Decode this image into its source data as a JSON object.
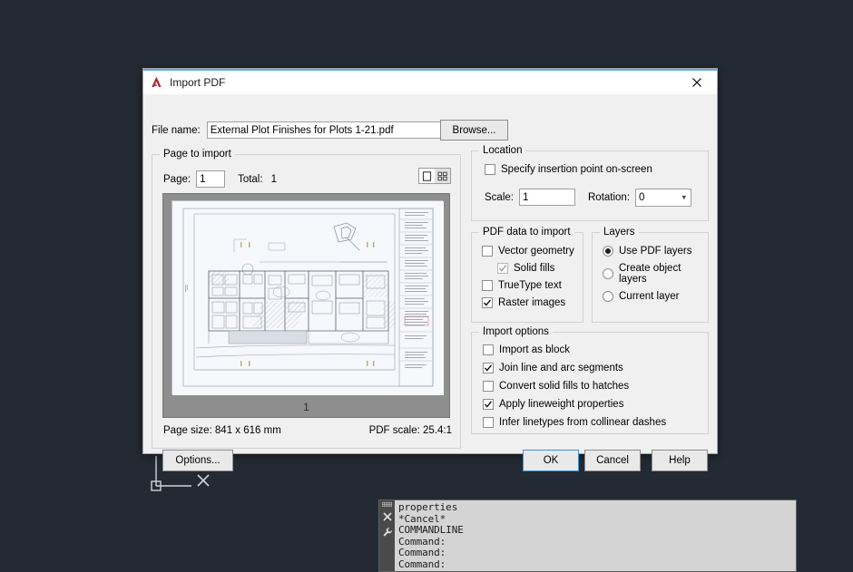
{
  "window": {
    "title": "Import PDF",
    "logo_icon": "autocad-a-logo",
    "close_icon": "close-icon"
  },
  "file": {
    "label": "File name:",
    "value": "External Plot Finishes for Plots 1-21.pdf",
    "browse_label": "Browse..."
  },
  "page_to_import": {
    "title": "Page to import",
    "page_label": "Page:",
    "page_value": "1",
    "total_label": "Total:",
    "total_value": "1",
    "view_single_icon": "single-page-view-icon",
    "view_grid_icon": "grid-view-icon",
    "preview_page_number": "1",
    "page_size_label": "Page size:",
    "page_size_value": "841 x 616 mm",
    "pdf_scale_label": "PDF scale:",
    "pdf_scale_value": "25.4:1"
  },
  "location": {
    "title": "Location",
    "specify_insertion": {
      "label": "Specify insertion point on-screen",
      "checked": false
    },
    "scale_label": "Scale:",
    "scale_value": "1",
    "rotation_label": "Rotation:",
    "rotation_value": "0",
    "dropdown_icon": "chevron-down-icon"
  },
  "pdf_data": {
    "title": "PDF data to import",
    "items": [
      {
        "label": "Vector geometry",
        "checked": false,
        "disabled": false,
        "indent": false
      },
      {
        "label": "Solid fills",
        "checked": true,
        "disabled": true,
        "indent": true
      },
      {
        "label": "TrueType text",
        "checked": false,
        "disabled": false,
        "indent": false
      },
      {
        "label": "Raster images",
        "checked": true,
        "disabled": false,
        "indent": false
      }
    ]
  },
  "layers": {
    "title": "Layers",
    "options": [
      {
        "label": "Use PDF layers",
        "selected": true
      },
      {
        "label": "Create object layers",
        "selected": false
      },
      {
        "label": "Current layer",
        "selected": false
      }
    ]
  },
  "import_options": {
    "title": "Import options",
    "items": [
      {
        "label": "Import as block",
        "checked": false
      },
      {
        "label": "Join line and arc segments",
        "checked": true
      },
      {
        "label": "Convert solid fills to hatches",
        "checked": false
      },
      {
        "label": "Apply lineweight properties",
        "checked": true
      },
      {
        "label": "Infer linetypes from collinear dashes",
        "checked": false
      }
    ]
  },
  "footer": {
    "options_label": "Options...",
    "ok_label": "OK",
    "cancel_label": "Cancel",
    "help_label": "Help"
  },
  "command_window": {
    "close_icon": "close-icon",
    "customize_icon": "wrench-icon",
    "grip_icon": "drag-grip-icon",
    "lines": [
      "properties",
      "*Cancel*",
      "COMMANDLINE",
      "Command:",
      "Command:",
      "Command:"
    ]
  },
  "colors": {
    "desktop_background": "#232a33",
    "dialog_background": "#f0f0f0",
    "accent_border": "#5aaee8",
    "default_button_border": "#3f92d2",
    "logo_red": "#b4292f"
  }
}
